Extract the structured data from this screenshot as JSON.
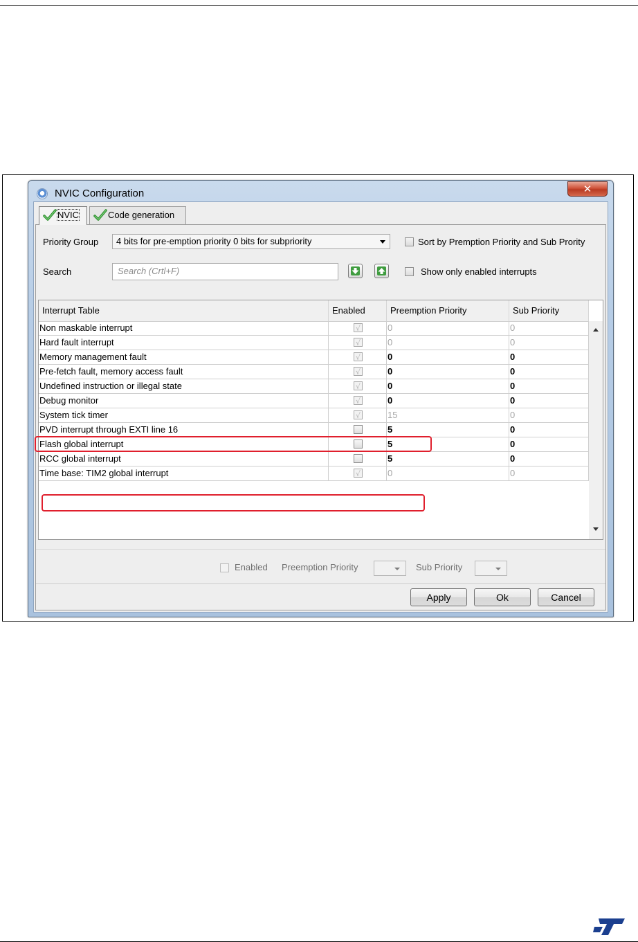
{
  "window": {
    "title": "NVIC Configuration",
    "close_glyph": "✕"
  },
  "tabs": [
    {
      "label": "NVIC",
      "icon": "check-icon",
      "active": true
    },
    {
      "label": "Code generation",
      "icon": "check-icon",
      "active": false
    }
  ],
  "priority_group": {
    "label": "Priority Group",
    "value": "4 bits for pre-emption priority 0 bits for subpriority"
  },
  "sort_option": {
    "label": "Sort by Premption Priority and Sub Prority",
    "checked": false
  },
  "search": {
    "label": "Search",
    "placeholder": "Search (Crtl+F)"
  },
  "show_enabled": {
    "label": "Show only enabled interrupts",
    "checked": false
  },
  "table": {
    "columns": [
      "Interrupt Table",
      "Enabled",
      "Preemption Priority",
      "Sub Priority"
    ],
    "rows": [
      {
        "name": "Non maskable interrupt",
        "enabled": true,
        "editable": false,
        "preemption": "0",
        "sub": "0",
        "highlight": false
      },
      {
        "name": "Hard fault interrupt",
        "enabled": true,
        "editable": false,
        "preemption": "0",
        "sub": "0",
        "highlight": false
      },
      {
        "name": "Memory management fault",
        "enabled": true,
        "editable": true,
        "preemption": "0",
        "sub": "0",
        "highlight": false
      },
      {
        "name": "Pre-fetch fault, memory access fault",
        "enabled": true,
        "editable": true,
        "preemption": "0",
        "sub": "0",
        "highlight": false
      },
      {
        "name": "Undefined instruction or illegal state",
        "enabled": true,
        "editable": true,
        "preemption": "0",
        "sub": "0",
        "highlight": false
      },
      {
        "name": "Debug monitor",
        "enabled": true,
        "editable": true,
        "preemption": "0",
        "sub": "0",
        "highlight": false
      },
      {
        "name": "System tick timer",
        "enabled": true,
        "editable": false,
        "preemption": "15",
        "sub": "0",
        "highlight": true
      },
      {
        "name": "PVD interrupt through EXTI line 16",
        "enabled": false,
        "editable": true,
        "preemption": "5",
        "sub": "0",
        "highlight": false
      },
      {
        "name": "Flash global interrupt",
        "enabled": false,
        "editable": true,
        "preemption": "5",
        "sub": "0",
        "highlight": false
      },
      {
        "name": "RCC global interrupt",
        "enabled": false,
        "editable": true,
        "preemption": "5",
        "sub": "0",
        "highlight": false
      },
      {
        "name": "Time base: TIM2 global interrupt",
        "enabled": true,
        "editable": false,
        "preemption": "0",
        "sub": "0",
        "highlight": true
      }
    ]
  },
  "editor": {
    "enabled_label": "Enabled",
    "preemption_label": "Preemption Priority",
    "sub_label": "Sub Priority"
  },
  "buttons": {
    "apply": "Apply",
    "ok": "Ok",
    "cancel": "Cancel"
  },
  "colors": {
    "highlight": "#e01f2d",
    "check_green": "#3aa63a",
    "logo": "#1a3e8c"
  }
}
